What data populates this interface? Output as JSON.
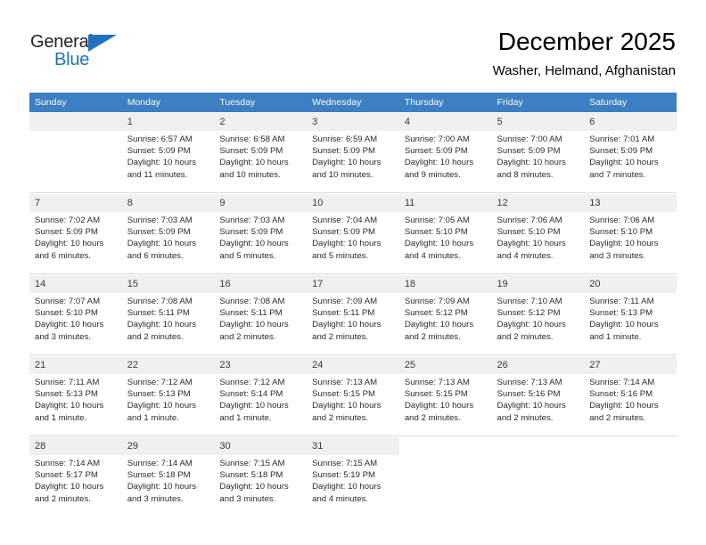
{
  "brand": {
    "name_dark": "General",
    "name_blue": "Blue",
    "accent_color": "#1f72bd"
  },
  "header": {
    "title": "December 2025",
    "subtitle": "Washer, Helmand, Afghanistan"
  },
  "calendar": {
    "header_bg": "#3c7fc2",
    "daynum_bg": "#f0f0f0",
    "weekdays": [
      "Sunday",
      "Monday",
      "Tuesday",
      "Wednesday",
      "Thursday",
      "Friday",
      "Saturday"
    ],
    "weeks": [
      [
        {
          "day": "",
          "sunrise": "",
          "sunset": "",
          "daylight1": "",
          "daylight2": ""
        },
        {
          "day": "1",
          "sunrise": "Sunrise: 6:57 AM",
          "sunset": "Sunset: 5:09 PM",
          "daylight1": "Daylight: 10 hours",
          "daylight2": "and 11 minutes."
        },
        {
          "day": "2",
          "sunrise": "Sunrise: 6:58 AM",
          "sunset": "Sunset: 5:09 PM",
          "daylight1": "Daylight: 10 hours",
          "daylight2": "and 10 minutes."
        },
        {
          "day": "3",
          "sunrise": "Sunrise: 6:59 AM",
          "sunset": "Sunset: 5:09 PM",
          "daylight1": "Daylight: 10 hours",
          "daylight2": "and 10 minutes."
        },
        {
          "day": "4",
          "sunrise": "Sunrise: 7:00 AM",
          "sunset": "Sunset: 5:09 PM",
          "daylight1": "Daylight: 10 hours",
          "daylight2": "and 9 minutes."
        },
        {
          "day": "5",
          "sunrise": "Sunrise: 7:00 AM",
          "sunset": "Sunset: 5:09 PM",
          "daylight1": "Daylight: 10 hours",
          "daylight2": "and 8 minutes."
        },
        {
          "day": "6",
          "sunrise": "Sunrise: 7:01 AM",
          "sunset": "Sunset: 5:09 PM",
          "daylight1": "Daylight: 10 hours",
          "daylight2": "and 7 minutes."
        }
      ],
      [
        {
          "day": "7",
          "sunrise": "Sunrise: 7:02 AM",
          "sunset": "Sunset: 5:09 PM",
          "daylight1": "Daylight: 10 hours",
          "daylight2": "and 6 minutes."
        },
        {
          "day": "8",
          "sunrise": "Sunrise: 7:03 AM",
          "sunset": "Sunset: 5:09 PM",
          "daylight1": "Daylight: 10 hours",
          "daylight2": "and 6 minutes."
        },
        {
          "day": "9",
          "sunrise": "Sunrise: 7:03 AM",
          "sunset": "Sunset: 5:09 PM",
          "daylight1": "Daylight: 10 hours",
          "daylight2": "and 5 minutes."
        },
        {
          "day": "10",
          "sunrise": "Sunrise: 7:04 AM",
          "sunset": "Sunset: 5:09 PM",
          "daylight1": "Daylight: 10 hours",
          "daylight2": "and 5 minutes."
        },
        {
          "day": "11",
          "sunrise": "Sunrise: 7:05 AM",
          "sunset": "Sunset: 5:10 PM",
          "daylight1": "Daylight: 10 hours",
          "daylight2": "and 4 minutes."
        },
        {
          "day": "12",
          "sunrise": "Sunrise: 7:06 AM",
          "sunset": "Sunset: 5:10 PM",
          "daylight1": "Daylight: 10 hours",
          "daylight2": "and 4 minutes."
        },
        {
          "day": "13",
          "sunrise": "Sunrise: 7:06 AM",
          "sunset": "Sunset: 5:10 PM",
          "daylight1": "Daylight: 10 hours",
          "daylight2": "and 3 minutes."
        }
      ],
      [
        {
          "day": "14",
          "sunrise": "Sunrise: 7:07 AM",
          "sunset": "Sunset: 5:10 PM",
          "daylight1": "Daylight: 10 hours",
          "daylight2": "and 3 minutes."
        },
        {
          "day": "15",
          "sunrise": "Sunrise: 7:08 AM",
          "sunset": "Sunset: 5:11 PM",
          "daylight1": "Daylight: 10 hours",
          "daylight2": "and 2 minutes."
        },
        {
          "day": "16",
          "sunrise": "Sunrise: 7:08 AM",
          "sunset": "Sunset: 5:11 PM",
          "daylight1": "Daylight: 10 hours",
          "daylight2": "and 2 minutes."
        },
        {
          "day": "17",
          "sunrise": "Sunrise: 7:09 AM",
          "sunset": "Sunset: 5:11 PM",
          "daylight1": "Daylight: 10 hours",
          "daylight2": "and 2 minutes."
        },
        {
          "day": "18",
          "sunrise": "Sunrise: 7:09 AM",
          "sunset": "Sunset: 5:12 PM",
          "daylight1": "Daylight: 10 hours",
          "daylight2": "and 2 minutes."
        },
        {
          "day": "19",
          "sunrise": "Sunrise: 7:10 AM",
          "sunset": "Sunset: 5:12 PM",
          "daylight1": "Daylight: 10 hours",
          "daylight2": "and 2 minutes."
        },
        {
          "day": "20",
          "sunrise": "Sunrise: 7:11 AM",
          "sunset": "Sunset: 5:13 PM",
          "daylight1": "Daylight: 10 hours",
          "daylight2": "and 1 minute."
        }
      ],
      [
        {
          "day": "21",
          "sunrise": "Sunrise: 7:11 AM",
          "sunset": "Sunset: 5:13 PM",
          "daylight1": "Daylight: 10 hours",
          "daylight2": "and 1 minute."
        },
        {
          "day": "22",
          "sunrise": "Sunrise: 7:12 AM",
          "sunset": "Sunset: 5:13 PM",
          "daylight1": "Daylight: 10 hours",
          "daylight2": "and 1 minute."
        },
        {
          "day": "23",
          "sunrise": "Sunrise: 7:12 AM",
          "sunset": "Sunset: 5:14 PM",
          "daylight1": "Daylight: 10 hours",
          "daylight2": "and 1 minute."
        },
        {
          "day": "24",
          "sunrise": "Sunrise: 7:13 AM",
          "sunset": "Sunset: 5:15 PM",
          "daylight1": "Daylight: 10 hours",
          "daylight2": "and 2 minutes."
        },
        {
          "day": "25",
          "sunrise": "Sunrise: 7:13 AM",
          "sunset": "Sunset: 5:15 PM",
          "daylight1": "Daylight: 10 hours",
          "daylight2": "and 2 minutes."
        },
        {
          "day": "26",
          "sunrise": "Sunrise: 7:13 AM",
          "sunset": "Sunset: 5:16 PM",
          "daylight1": "Daylight: 10 hours",
          "daylight2": "and 2 minutes."
        },
        {
          "day": "27",
          "sunrise": "Sunrise: 7:14 AM",
          "sunset": "Sunset: 5:16 PM",
          "daylight1": "Daylight: 10 hours",
          "daylight2": "and 2 minutes."
        }
      ],
      [
        {
          "day": "28",
          "sunrise": "Sunrise: 7:14 AM",
          "sunset": "Sunset: 5:17 PM",
          "daylight1": "Daylight: 10 hours",
          "daylight2": "and 2 minutes."
        },
        {
          "day": "29",
          "sunrise": "Sunrise: 7:14 AM",
          "sunset": "Sunset: 5:18 PM",
          "daylight1": "Daylight: 10 hours",
          "daylight2": "and 3 minutes."
        },
        {
          "day": "30",
          "sunrise": "Sunrise: 7:15 AM",
          "sunset": "Sunset: 5:18 PM",
          "daylight1": "Daylight: 10 hours",
          "daylight2": "and 3 minutes."
        },
        {
          "day": "31",
          "sunrise": "Sunrise: 7:15 AM",
          "sunset": "Sunset: 5:19 PM",
          "daylight1": "Daylight: 10 hours",
          "daylight2": "and 4 minutes."
        },
        {
          "day": "",
          "sunrise": "",
          "sunset": "",
          "daylight1": "",
          "daylight2": ""
        },
        {
          "day": "",
          "sunrise": "",
          "sunset": "",
          "daylight1": "",
          "daylight2": ""
        },
        {
          "day": "",
          "sunrise": "",
          "sunset": "",
          "daylight1": "",
          "daylight2": ""
        }
      ]
    ]
  }
}
